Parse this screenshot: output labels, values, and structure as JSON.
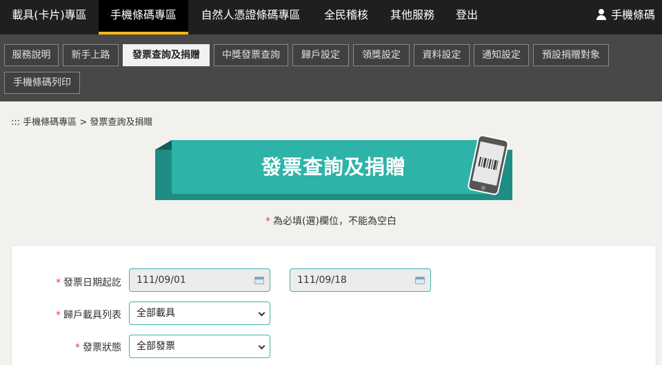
{
  "topnav": {
    "items": [
      {
        "label": "載具(卡片)專區",
        "active": false
      },
      {
        "label": "手機條碼專區",
        "active": true
      },
      {
        "label": "自然人憑證條碼專區",
        "active": false
      },
      {
        "label": "全民稽核",
        "active": false
      },
      {
        "label": "其他服務",
        "active": false
      },
      {
        "label": "登出",
        "active": false
      }
    ],
    "user_label": "手機條碼"
  },
  "subnav": {
    "items": [
      {
        "label": "服務說明",
        "active": false
      },
      {
        "label": "新手上路",
        "active": false
      },
      {
        "label": "發票查詢及捐贈",
        "active": true
      },
      {
        "label": "中獎發票查詢",
        "active": false
      },
      {
        "label": "歸戶設定",
        "active": false
      },
      {
        "label": "領獎設定",
        "active": false
      },
      {
        "label": "資料設定",
        "active": false
      },
      {
        "label": "通知設定",
        "active": false
      },
      {
        "label": "預設捐贈對象",
        "active": false
      },
      {
        "label": "手機條碼列印",
        "active": false
      }
    ]
  },
  "breadcrumb": ":::  手機條碼專區 > 發票查詢及捐贈",
  "banner": {
    "title": "發票查詢及捐贈"
  },
  "required_note": {
    "star": "*",
    "text": "為必填(選)欄位，不能為空白"
  },
  "form": {
    "date_label": "發票日期起訖",
    "date_from": "111/09/01",
    "date_to": "111/09/18",
    "carrier_label": "歸戶載具列表",
    "carrier_value": "全部載具",
    "status_label": "發票狀態",
    "status_value": "全部發票",
    "required_star": "*"
  },
  "colors": {
    "topnav_bg": "#1f1f1f",
    "active_underline": "#f5b51b",
    "subnav_bg": "#484848",
    "banner_teal": "#2db3a8",
    "input_border": "#3fb2a8",
    "required_star": "#e53a3a"
  }
}
